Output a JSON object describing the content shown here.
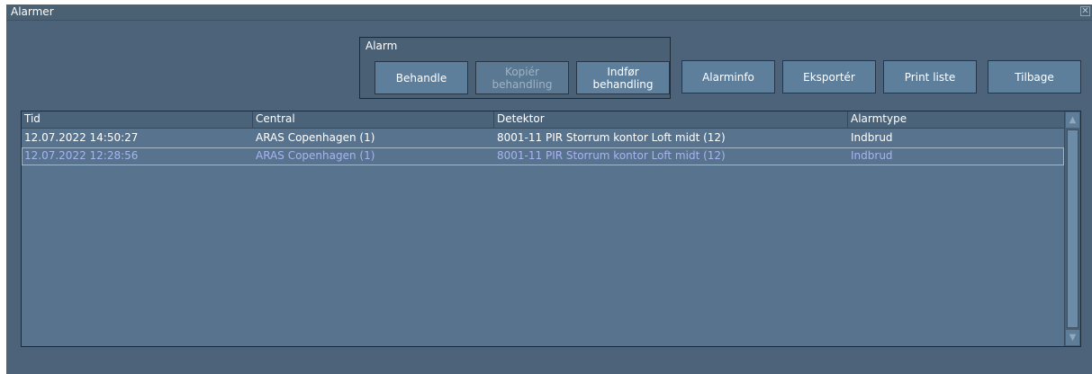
{
  "window": {
    "title": "Alarmer",
    "close_glyph": "✕"
  },
  "alarm_group": {
    "label": "Alarm",
    "buttons": [
      {
        "label": "Behandle",
        "enabled": true
      },
      {
        "label": "Kopiér behandling",
        "enabled": false
      },
      {
        "label": "Indfør behandling",
        "enabled": true
      }
    ]
  },
  "toolbar": {
    "alarminfo": "Alarminfo",
    "eksporter": "Eksportér",
    "print": "Print liste",
    "tilbage": "Tilbage"
  },
  "table": {
    "columns": [
      "Tid",
      "Central",
      "Detektor",
      "Alarmtype"
    ],
    "rows": [
      {
        "tid": "12.07.2022 14:50:27",
        "central": "ARAS Copenhagen (1)",
        "detektor": "8001-11 PIR Storrum kontor Loft midt (12)",
        "alarmtype": "Indbrud",
        "selected": false
      },
      {
        "tid": "12.07.2022 12:28:56",
        "central": "ARAS Copenhagen (1)",
        "detektor": "8001-11 PIR Storrum kontor Loft midt (12)",
        "alarmtype": "Indbrud",
        "selected": true
      }
    ]
  },
  "scrollbar": {
    "up_icon": "▲",
    "down_icon": "▼"
  },
  "colors": {
    "background": "#4d6379",
    "button": "#5e7f9b",
    "selected_text": "#a8b4f0"
  }
}
